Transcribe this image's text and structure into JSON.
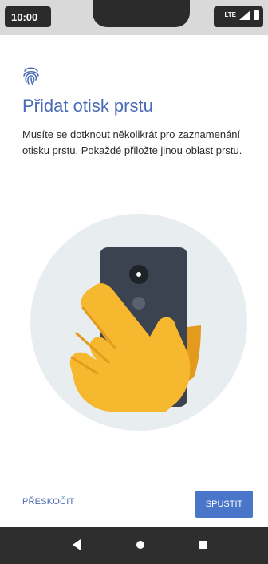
{
  "status_bar": {
    "time": "10:00",
    "network": "LTE"
  },
  "header": {
    "icon": "fingerprint-icon",
    "title": "Přidat otisk prstu",
    "description": "Musíte se dotknout několikrát pro zaznamenání otisku prstu. Pokaždé přiložte jinou oblast prstu."
  },
  "actions": {
    "skip_label": "PŘESKOČIT",
    "start_label": "SPUSTIT"
  },
  "nav_bar": {
    "icons": [
      "back-icon",
      "home-icon",
      "recents-icon"
    ]
  },
  "colors": {
    "accent": "#4a6bb5",
    "button": "#4a76c9",
    "hand": "#f5b82e",
    "phone": "#3c4350",
    "circle": "#e8edf0"
  }
}
